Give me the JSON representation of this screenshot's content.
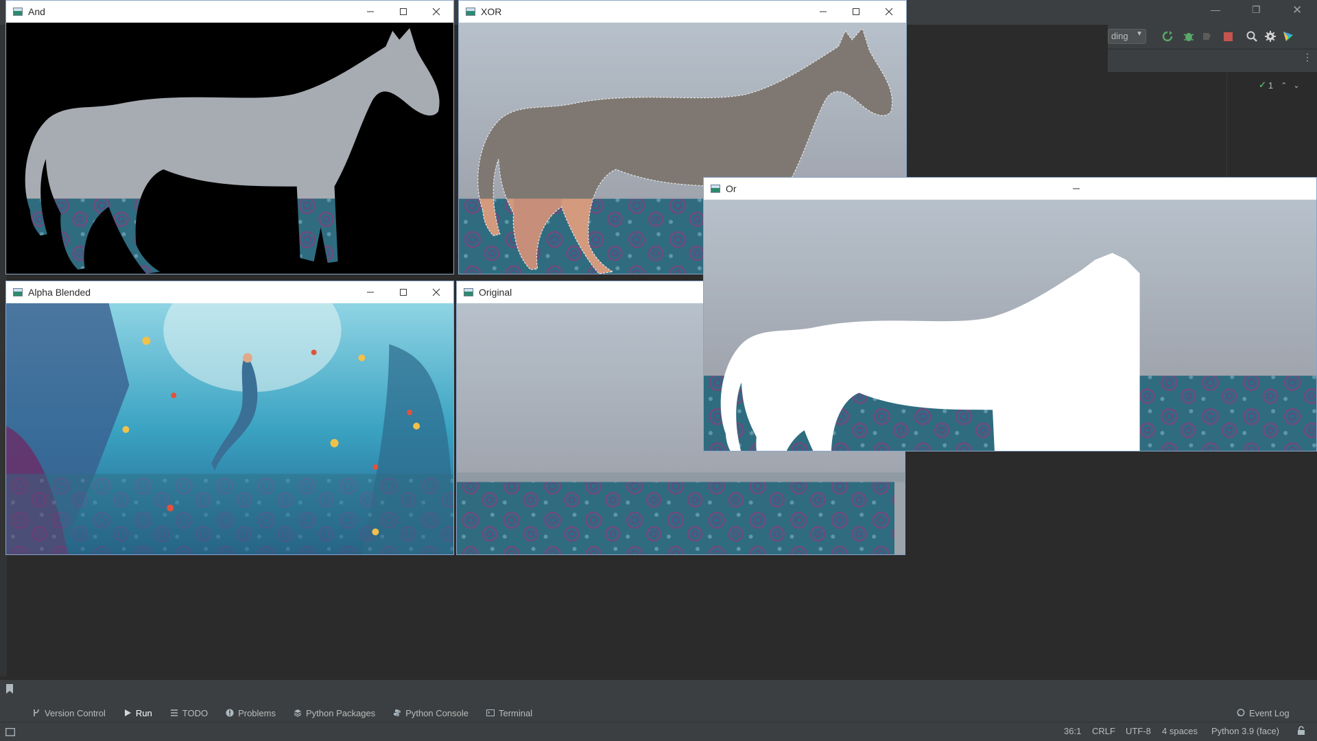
{
  "windows": {
    "and": {
      "title": "And"
    },
    "xor": {
      "title": "XOR"
    },
    "or": {
      "title": "Or"
    },
    "alpha": {
      "title": "Alpha Blended"
    },
    "original": {
      "title": "Original"
    }
  },
  "ide": {
    "run_config_partial": "ding",
    "inspection_count": "1",
    "tool_windows": [
      {
        "label": "Version Control",
        "icon": "branch-icon"
      },
      {
        "label": "Run",
        "icon": "run-icon",
        "active": true
      },
      {
        "label": "TODO",
        "icon": "list-icon"
      },
      {
        "label": "Problems",
        "icon": "info-icon"
      },
      {
        "label": "Python Packages",
        "icon": "layers-icon"
      },
      {
        "label": "Python Console",
        "icon": "python-icon"
      },
      {
        "label": "Terminal",
        "icon": "terminal-icon"
      }
    ],
    "event_log": "Event Log",
    "status": {
      "position": "36:1",
      "line_ending": "CRLF",
      "encoding": "UTF-8",
      "indent": "4 spaces",
      "interpreter": "Python 3.9 (face)"
    },
    "partial_line_number": "36"
  }
}
